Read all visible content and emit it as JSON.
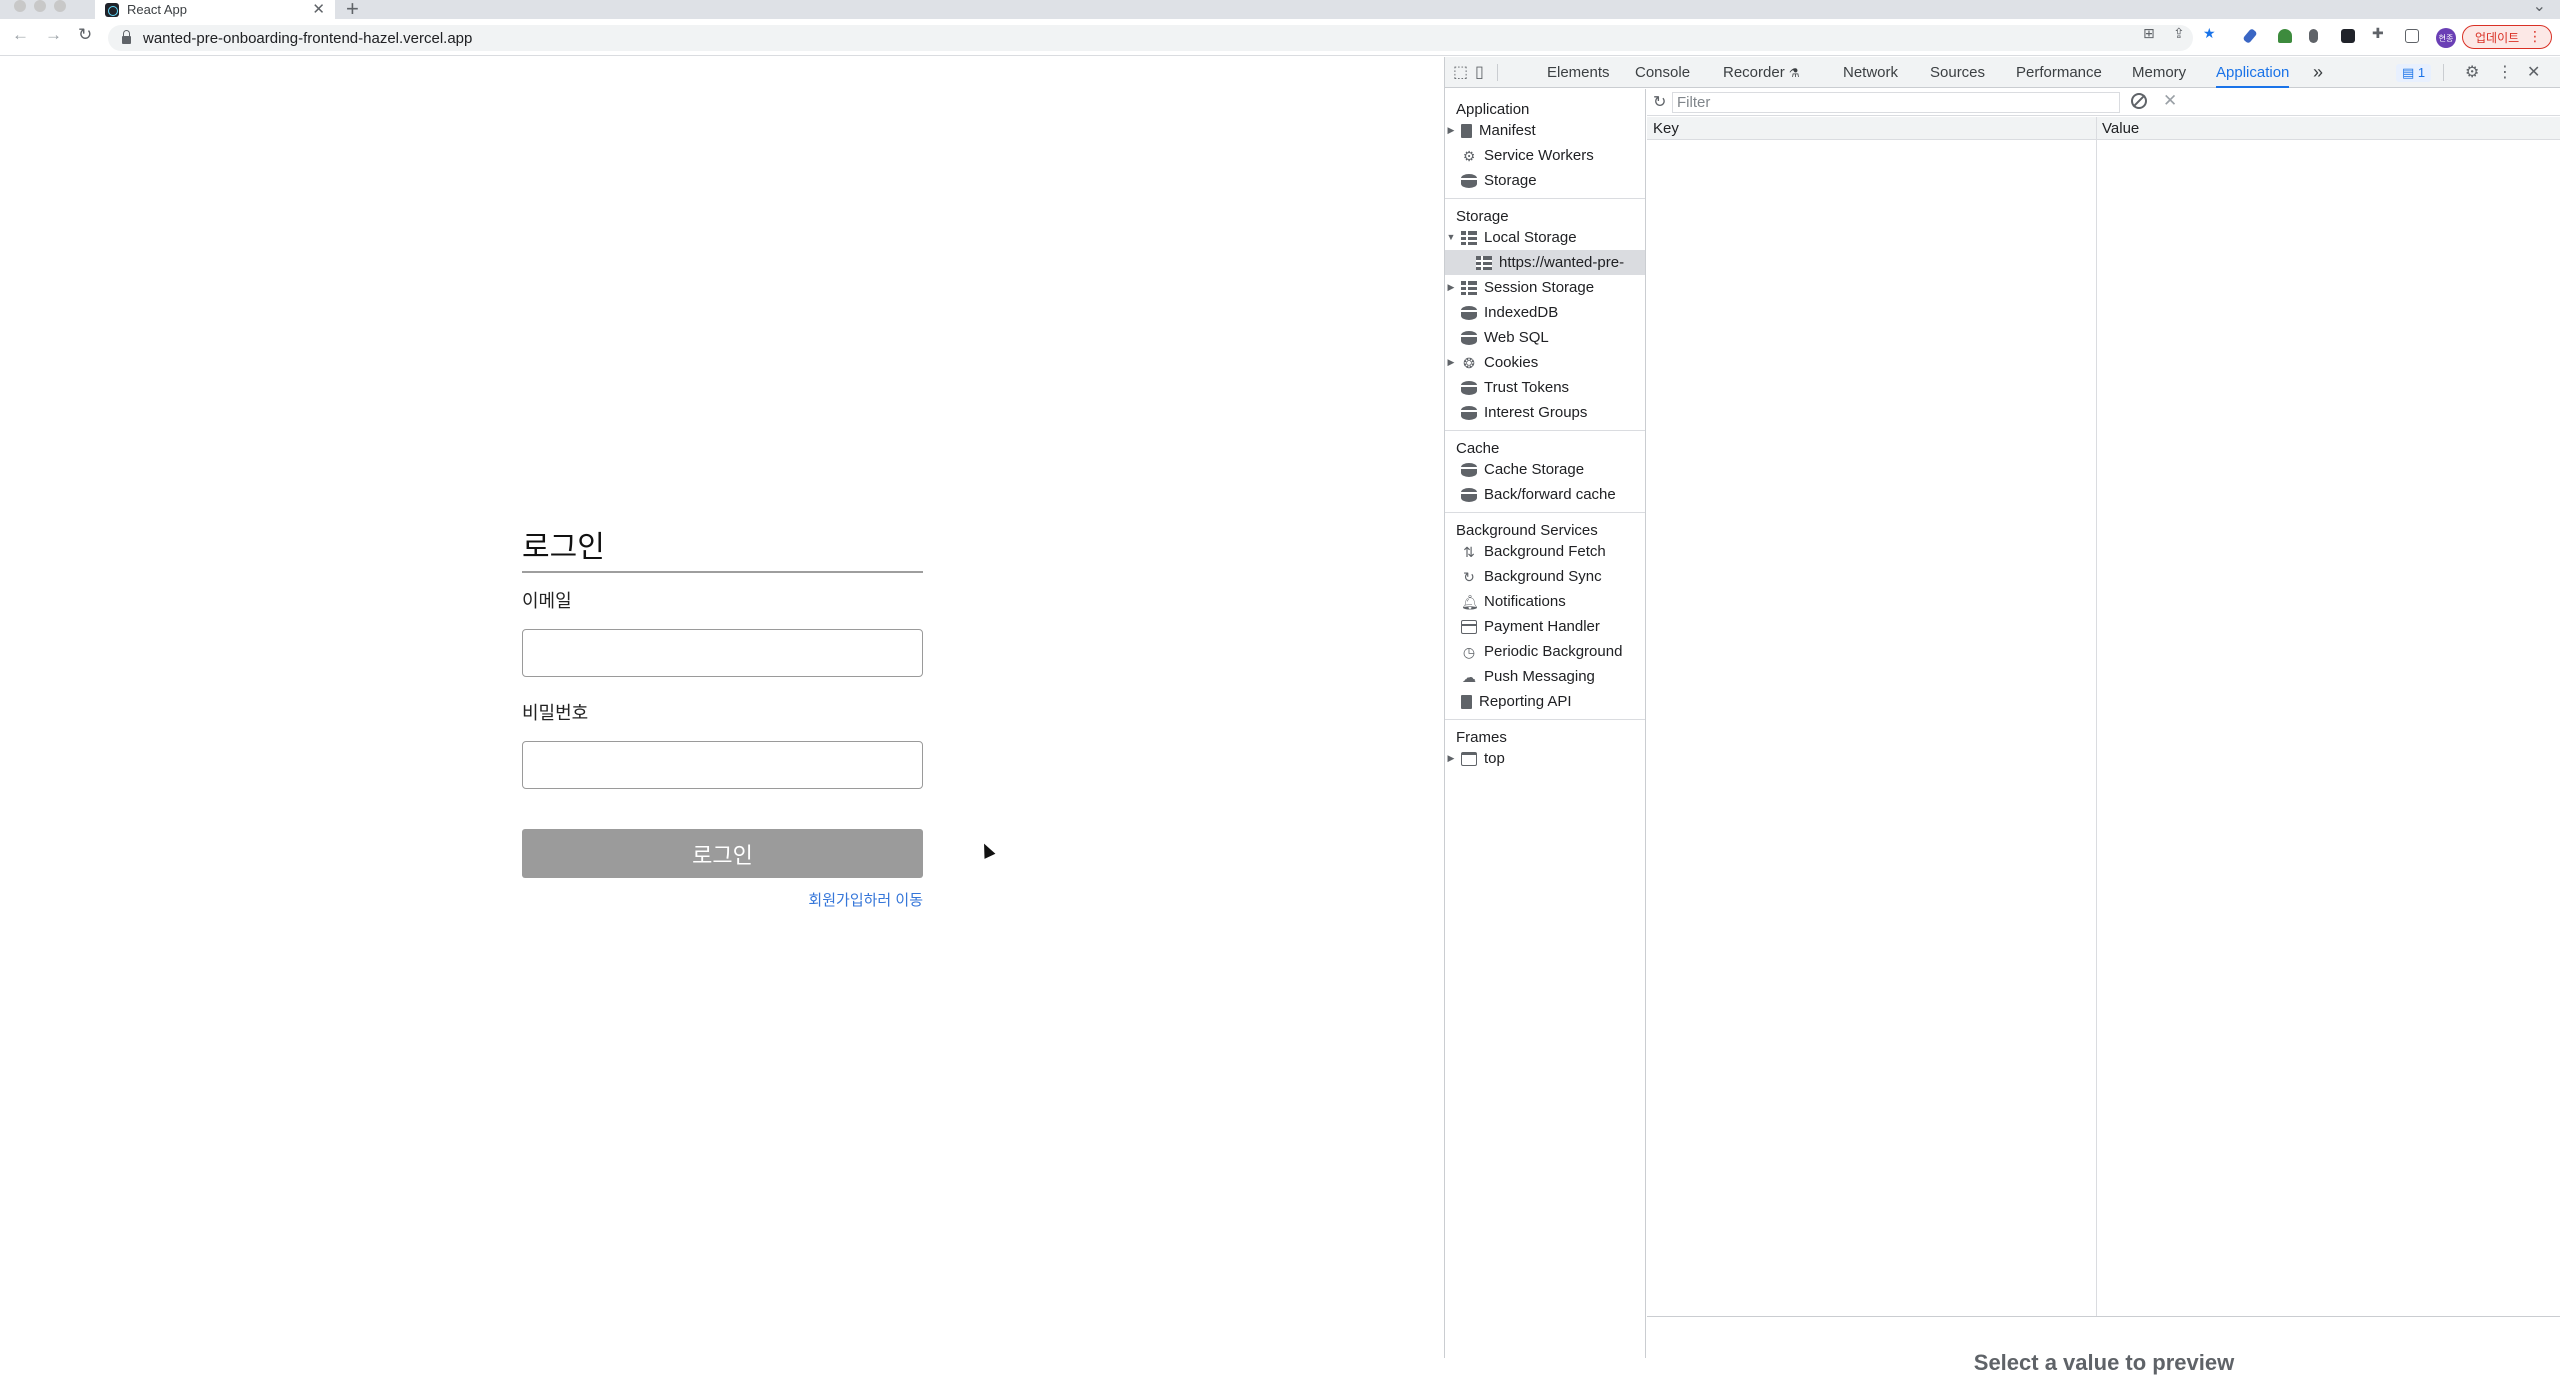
{
  "browser": {
    "tab_title": "React App",
    "tab_close": "✕",
    "new_tab": "+",
    "tab_search": "⌄",
    "url": "wanted-pre-onboarding-frontend-hazel.vercel.app",
    "back": "←",
    "forward": "→",
    "reload": "↻",
    "profile_initials": "현종",
    "update_label": "업데이트",
    "menu_dots": "⋮"
  },
  "page": {
    "title": "로그인",
    "email_label": "이메일",
    "email_value": "",
    "password_label": "비밀번호",
    "password_value": "",
    "submit_label": "로그인",
    "signup_link": "회원가입하러 이동"
  },
  "devtools": {
    "tabs": [
      "Elements",
      "Console",
      "Recorder",
      "Network",
      "Sources",
      "Performance",
      "Memory",
      "Application"
    ],
    "active_tab": "Application",
    "recorder_badge": "⚗",
    "more_tabs": "»",
    "issues_count": "1",
    "close": "✕",
    "sidebar": {
      "application": {
        "header": "Application",
        "items": [
          "Manifest",
          "Service Workers",
          "Storage"
        ]
      },
      "storage": {
        "header": "Storage",
        "items": [
          "Local Storage",
          "https://wanted-pre-",
          "Session Storage",
          "IndexedDB",
          "Web SQL",
          "Cookies",
          "Trust Tokens",
          "Interest Groups"
        ]
      },
      "cache": {
        "header": "Cache",
        "items": [
          "Cache Storage",
          "Back/forward cache"
        ]
      },
      "background": {
        "header": "Background Services",
        "items": [
          "Background Fetch",
          "Background Sync",
          "Notifications",
          "Payment Handler",
          "Periodic Background",
          "Push Messaging",
          "Reporting API"
        ]
      },
      "frames": {
        "header": "Frames",
        "items": [
          "top"
        ]
      }
    },
    "filter_placeholder": "Filter",
    "columns": {
      "key": "Key",
      "value": "Value"
    },
    "preview_text": "Select a value to preview"
  },
  "colors": {
    "accent": "#1a73e8",
    "login_button": "#9b9b9b",
    "link": "#3576d9",
    "update": "#d93025"
  }
}
